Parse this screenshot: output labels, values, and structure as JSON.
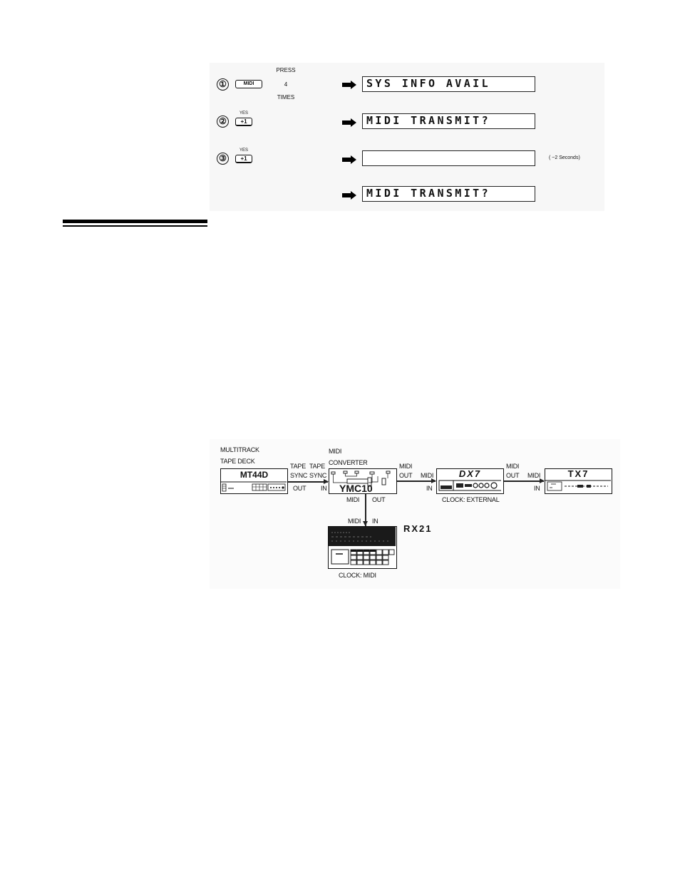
{
  "procedure": {
    "steps": [
      {
        "number": "①",
        "key_label": "MIDI",
        "press_label_top": "PRESS",
        "press_count": "4",
        "press_label_bottom": "TIMES",
        "display": "SYS INFO AVAIL"
      },
      {
        "number": "②",
        "key_caption": "YES",
        "key_label": "+1",
        "display": "MIDI TRANSMIT?"
      },
      {
        "number": "③",
        "key_caption": "YES",
        "key_label": "+1",
        "display": "",
        "note": "( ~2 Seconds)"
      },
      {
        "display": "MIDI TRANSMIT?"
      }
    ]
  },
  "diagram": {
    "devices": {
      "tape_deck": {
        "caption_line1": "MULTITRACK",
        "caption_line2": "TAPE DECK",
        "name": "MT44D"
      },
      "converter": {
        "caption_line1": "MIDI",
        "caption_line2": "CONVERTER",
        "name": "YMC10"
      },
      "keyboard": {
        "name": "DX7",
        "clock_label": "CLOCK: EXTERNAL"
      },
      "tone_module": {
        "name": "TX7"
      },
      "drum_machine": {
        "name": "RX21",
        "clock_label": "CLOCK: MIDI"
      }
    },
    "ports": {
      "tape_sync_out_top": "TAPE",
      "tape_sync_out_mid": "SYNC",
      "tape_sync_out_bottom": "OUT",
      "tape_sync_in_top": "TAPE",
      "tape_sync_in_mid": "SYNC",
      "tape_sync_in_bottom": "IN",
      "conv_midi_out_top": "MIDI",
      "conv_midi_out_bottom": "OUT",
      "dx7_midi_in_top": "MIDI",
      "dx7_midi_in_bottom": "IN",
      "dx7_midi_out_top": "MIDI",
      "dx7_midi_out_bottom": "OUT",
      "tx7_midi_in_top": "MIDI",
      "tx7_midi_in_bottom": "IN",
      "conv_midi_out2_left": "MIDI",
      "conv_midi_out2_right": "OUT",
      "rx21_midi_in_left": "MIDI",
      "rx21_midi_in_right": "IN"
    }
  }
}
